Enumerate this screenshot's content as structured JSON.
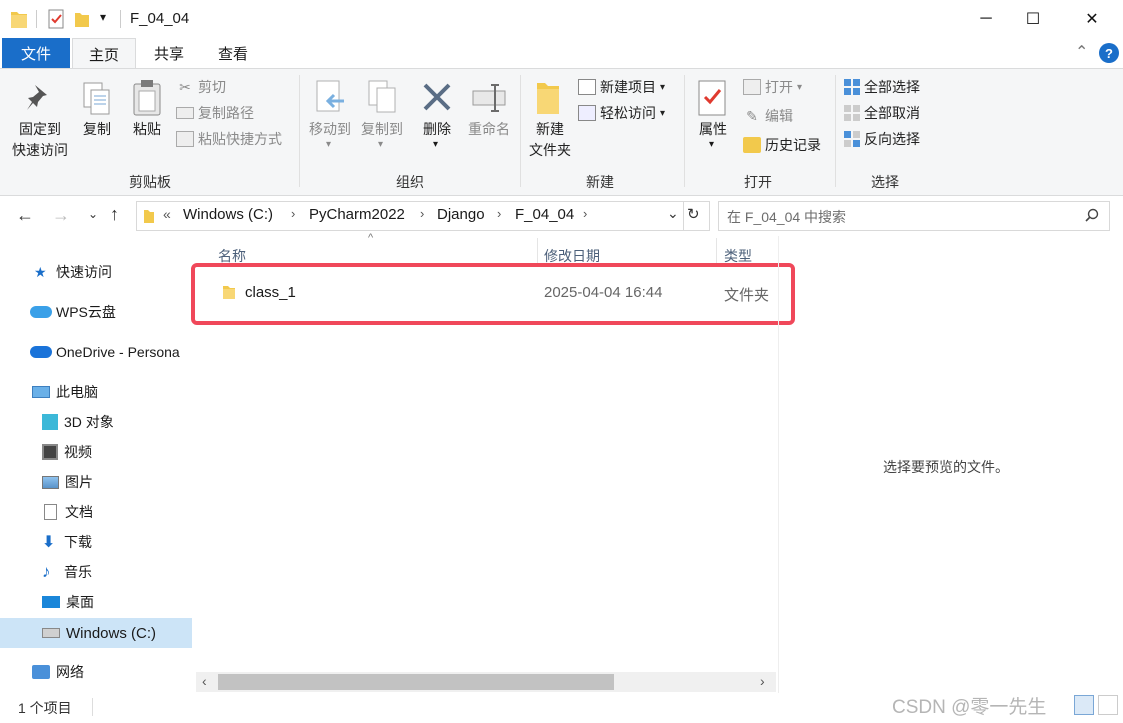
{
  "window": {
    "title": "F_04_04",
    "qat_dropdown": "▾",
    "minimize": "─",
    "maximize": "☐",
    "close": "✕",
    "help": "?",
    "collapse": "⌃"
  },
  "tabs": [
    "文件",
    "主页",
    "共享",
    "查看"
  ],
  "ribbon": {
    "clipboard": {
      "pin_line1": "固定到",
      "pin_line2": "快速访问",
      "copy": "复制",
      "paste": "粘贴",
      "cut": "剪切",
      "copy_path": "复制路径",
      "paste_shortcut": "粘贴快捷方式",
      "label": "剪贴板"
    },
    "organize": {
      "move_to": "移动到",
      "copy_to": "复制到",
      "delete": "删除",
      "rename": "重命名",
      "label": "组织"
    },
    "new": {
      "new_folder_line1": "新建",
      "new_folder_line2": "文件夹",
      "new_item": "新建项目",
      "easy_access": "轻松访问",
      "label": "新建"
    },
    "open": {
      "properties": "属性",
      "open": "打开",
      "edit": "编辑",
      "history": "历史记录",
      "label": "打开"
    },
    "select": {
      "select_all": "全部选择",
      "select_none": "全部取消",
      "invert": "反向选择",
      "label": "选择"
    }
  },
  "address": {
    "prefix": "«",
    "crumbs": [
      "Windows (C:)",
      "PyCharm2022",
      "Django",
      "F_04_04"
    ],
    "search_placeholder": "在 F_04_04 中搜索"
  },
  "nav": {
    "quick_access": "快速访问",
    "wps": "WPS云盘",
    "onedrive": "OneDrive - Persona",
    "this_pc": "此电脑",
    "pc_items": [
      "3D 对象",
      "视频",
      "图片",
      "文档",
      "下载",
      "音乐",
      "桌面",
      "Windows (C:)"
    ],
    "network": "网络"
  },
  "columns": {
    "name": "名称",
    "modified": "修改日期",
    "type": "类型"
  },
  "files": [
    {
      "name": "class_1",
      "modified": "2025-04-04 16:44",
      "type": "文件夹"
    }
  ],
  "preview_text": "选择要预览的文件。",
  "status": {
    "count": "1 个项目"
  },
  "watermark": "CSDN @零一先生",
  "colors": {
    "accent": "#1a6ec9",
    "highlight_box": "#f0485a",
    "selected_nav": "#cce4f7"
  }
}
